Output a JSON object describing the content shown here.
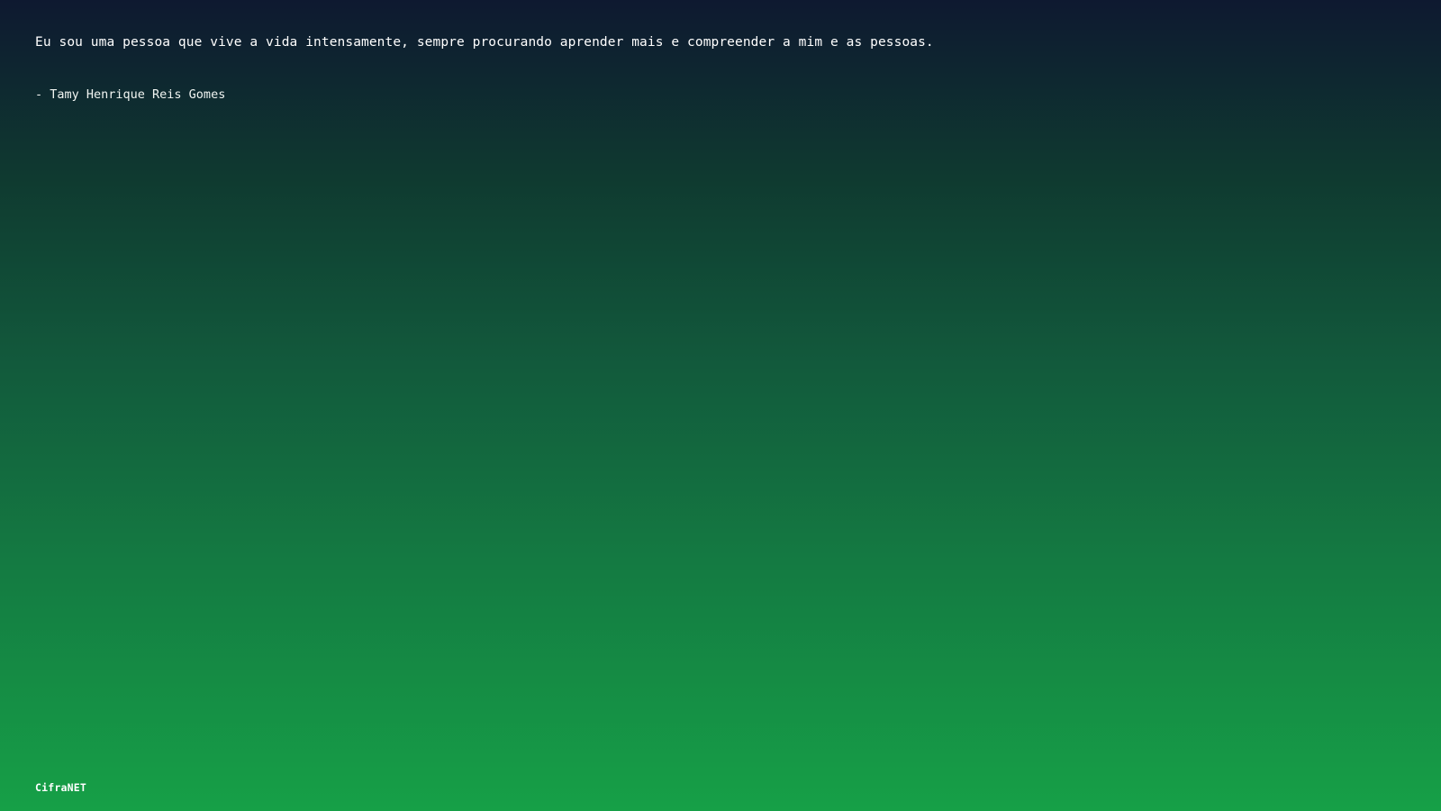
{
  "quote": {
    "text": "Eu sou uma pessoa que vive a vida intensamente, sempre procurando aprender mais e compreender a mim e as pessoas.",
    "author": "- Tamy Henrique Reis Gomes"
  },
  "footer": {
    "brand": "CifraNET"
  },
  "colors": {
    "background_top": "#0e1930",
    "background_bottom": "#16a047",
    "text": "#ffffff"
  }
}
